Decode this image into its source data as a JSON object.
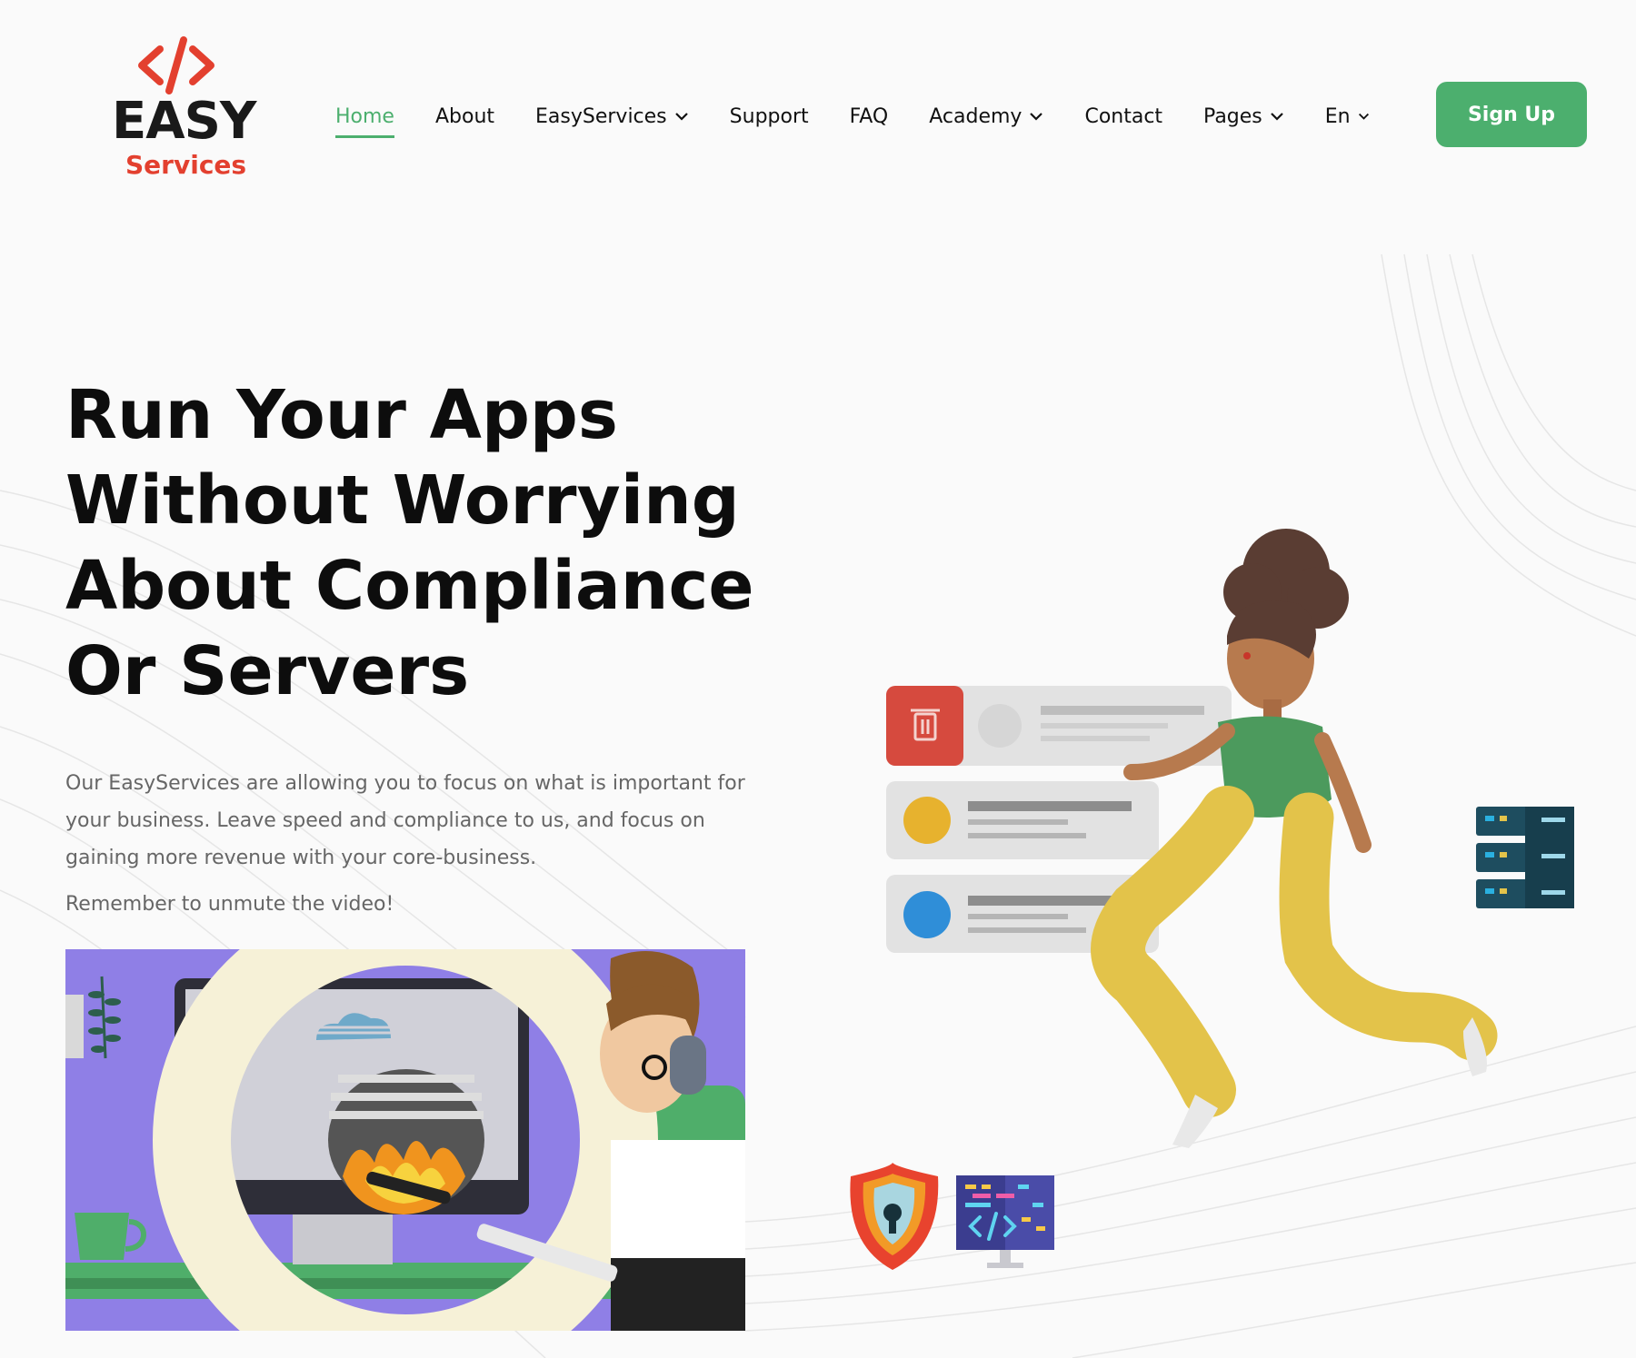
{
  "logo": {
    "brand_main": "EASY",
    "brand_sub": "Services"
  },
  "nav": {
    "items": [
      {
        "label": "Home",
        "active": true,
        "dropdown": false
      },
      {
        "label": "About",
        "active": false,
        "dropdown": false
      },
      {
        "label": "EasyServices",
        "active": false,
        "dropdown": true
      },
      {
        "label": "Support",
        "active": false,
        "dropdown": false
      },
      {
        "label": "FAQ",
        "active": false,
        "dropdown": false
      },
      {
        "label": "Academy",
        "active": false,
        "dropdown": true
      },
      {
        "label": "Contact",
        "active": false,
        "dropdown": false
      },
      {
        "label": "Pages",
        "active": false,
        "dropdown": true
      },
      {
        "label": "En",
        "active": false,
        "dropdown": true
      }
    ],
    "signup_label": "Sign Up"
  },
  "hero": {
    "title_lines": [
      "Run Your Apps",
      "Without Worrying",
      "About Compliance",
      "Or Servers"
    ],
    "description": "Our EasyServices are allowing you to focus on what is important for your business. Leave speed and compliance to us, and focus on gaining more revenue with your core-business.",
    "note": "Remember to unmute the video!"
  },
  "colors": {
    "accent": "#4caf6e",
    "brand_red": "#e3402f",
    "text_dark": "#111111",
    "text_muted": "#666666",
    "video_purple": "#8f7fe6"
  },
  "icons": [
    "code-icon",
    "chevron-down-icon",
    "trash-icon",
    "shield-icon",
    "server-icon",
    "code-monitor-icon"
  ]
}
